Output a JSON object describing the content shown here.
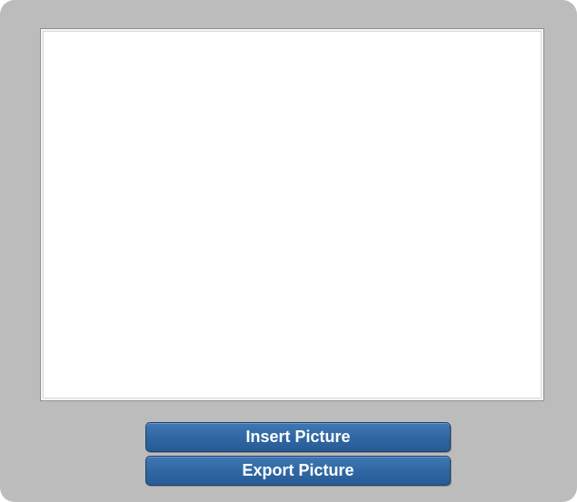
{
  "canvas": {
    "state": "empty"
  },
  "actions": {
    "insert_label": "Insert Picture",
    "export_label": "Export Picture"
  },
  "colors": {
    "panel_background": "#bcbcbc",
    "canvas_background": "#ffffff",
    "button_background": "#2f66a3",
    "button_text": "#ffffff"
  }
}
